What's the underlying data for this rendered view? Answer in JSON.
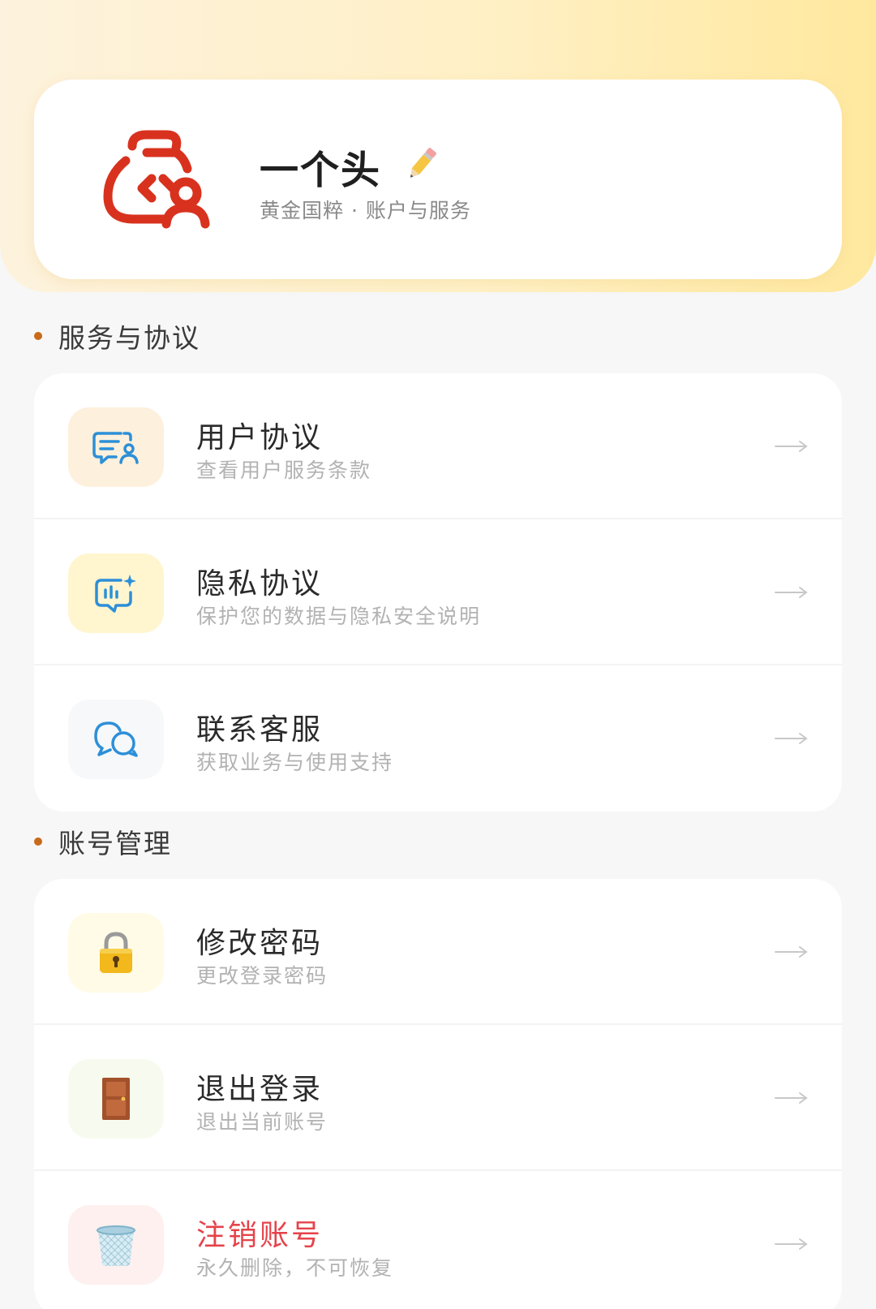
{
  "profile": {
    "nickname": "一个头",
    "subtitle": "黄金国粹 · 账户与服务",
    "avatar_icon": "red-money-bag-user-icon",
    "edit_icon": "pencil-icon"
  },
  "sections": [
    {
      "title": "服务与协议",
      "items": [
        {
          "title": "用户协议",
          "desc": "查看用户服务条款",
          "icon": "agreement-user-icon",
          "icon_bg": "#fdf0dc"
        },
        {
          "title": "隐私协议",
          "desc": "保护您的数据与隐私安全说明",
          "icon": "privacy-chat-chart-icon",
          "icon_bg": "#fff5cf"
        },
        {
          "title": "联系客服",
          "desc": "获取业务与使用支持",
          "icon": "chat-bubbles-icon",
          "icon_bg": "#f6f8fa"
        }
      ]
    },
    {
      "title": "账号管理",
      "items": [
        {
          "title": "修改密码",
          "desc": "更改登录密码",
          "icon": "padlock-icon",
          "icon_bg": "#fffbe6"
        },
        {
          "title": "退出登录",
          "desc": "退出当前账号",
          "icon": "door-icon",
          "icon_bg": "#f7fbef"
        },
        {
          "title": "注销账号",
          "desc": "永久删除，不可恢复",
          "icon": "trash-can-icon",
          "icon_bg": "#fdf0ef",
          "danger": true
        }
      ]
    }
  ],
  "colors": {
    "accent_dot": "#c86a1a",
    "danger": "#e5434a",
    "logo_red": "#d8321f",
    "icon_blue": "#2d8fd8"
  }
}
